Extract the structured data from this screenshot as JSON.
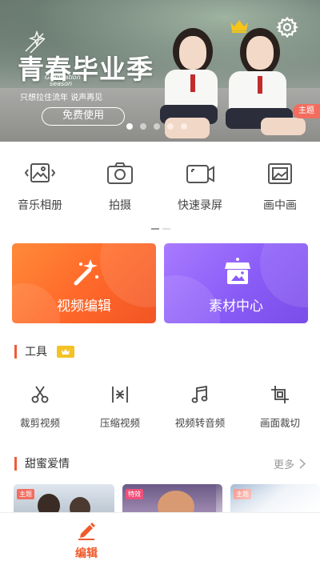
{
  "banner": {
    "title": "青春毕业季",
    "english_line1": "Graduation",
    "english_line2": "season",
    "subtitle": "只想拉住流年 说声再见",
    "cta_label": "免费使用",
    "tag_label": "主题",
    "carousel_count": 5,
    "carousel_active_index": 0
  },
  "quick_actions": [
    {
      "label": "音乐相册",
      "icon": "photo-album-icon"
    },
    {
      "label": "拍摄",
      "icon": "camera-icon"
    },
    {
      "label": "快速录屏",
      "icon": "screen-record-icon"
    },
    {
      "label": "画中画",
      "icon": "picture-in-picture-icon"
    }
  ],
  "feature_cards": [
    {
      "label": "视频编辑",
      "icon": "magic-wand-icon",
      "color": "#ff6a2a"
    },
    {
      "label": "素材中心",
      "icon": "store-icon",
      "color": "#8a5cf7"
    }
  ],
  "tools_section": {
    "title": "工具",
    "tools": [
      {
        "label": "裁剪视频",
        "icon": "scissors-icon"
      },
      {
        "label": "压缩视频",
        "icon": "compress-icon"
      },
      {
        "label": "视频转音频",
        "icon": "music-note-icon"
      },
      {
        "label": "画面裁切",
        "icon": "crop-icon"
      }
    ]
  },
  "love_section": {
    "title": "甜蜜爱情",
    "more_label": "更多",
    "thumbs": [
      {
        "tag": "主题",
        "tag_color": "#f26d5f"
      },
      {
        "tag": "特效",
        "tag_color": "#f0507a"
      },
      {
        "tag": "主题",
        "tag_color": "#f26d5f"
      }
    ]
  },
  "bottom_nav": {
    "edit_label": "编辑"
  },
  "colors": {
    "accent": "#f05a2a",
    "vip_gold": "#f3c326"
  }
}
